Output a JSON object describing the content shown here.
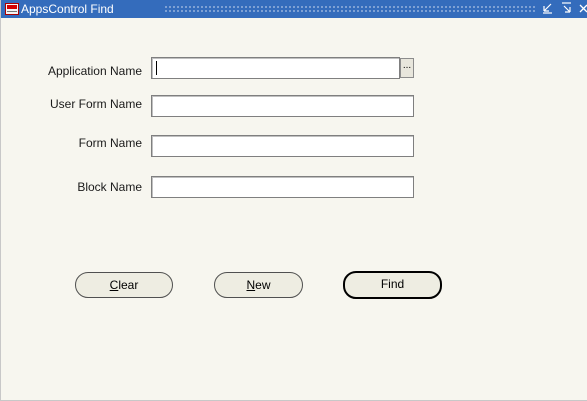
{
  "window": {
    "title": "AppsControl Find"
  },
  "titlebar_icons": [
    "minimize-icon",
    "maximize-icon",
    "close-icon"
  ],
  "form": {
    "fields": [
      {
        "label": "Application Name",
        "value": "",
        "has_lov": true,
        "focused": true
      },
      {
        "label": "User Form Name",
        "value": ""
      },
      {
        "label": "Form Name",
        "value": ""
      },
      {
        "label": "Block Name",
        "value": ""
      }
    ],
    "lov_button_label": "..."
  },
  "buttons": {
    "clear": {
      "mnemonic": "C",
      "rest": "lear"
    },
    "new": {
      "mnemonic": "N",
      "rest": "ew"
    },
    "find": {
      "label": "Find"
    }
  },
  "colors": {
    "titlebar": "#346cbc",
    "window_bg": "#f7f6ef",
    "button_bg": "#eeede2"
  }
}
